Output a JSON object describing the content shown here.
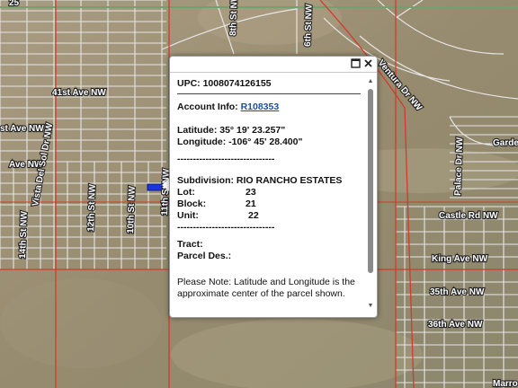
{
  "map": {
    "road_labels": [
      "25",
      "8th St NW",
      "6th St NW",
      "Ventura Dr NW",
      "41st Ave NW",
      "st Ave NW",
      "Ave NW",
      "Vista Del Sol Dr NW",
      "12th St NW",
      "14th St NW",
      "10th St NW",
      "11th St NW",
      "Garden",
      "Palace Dr NW",
      "Castle Rd NW",
      "King Ave NW",
      "35th Ave NW",
      "36th Ave NW",
      "Marro"
    ]
  },
  "popup": {
    "upc_label": "UPC:",
    "upc_value": "1008074126155",
    "account_label": "Account Info:",
    "account_value": "R108353",
    "latitude": "Latitude: 35° 19' 23.257\"",
    "longitude": "Longitude: -106° 45' 28.400\"",
    "dashes1": "-------------------------------",
    "subdivision_label": "Subdivision:",
    "subdivision_value": "RIO RANCHO ESTATES",
    "lot_label": "Lot:",
    "lot_value": "23",
    "block_label": "Block:",
    "block_value": "21",
    "unit_label": "Unit:",
    "unit_value": "22",
    "dashes2": "-------------------------------",
    "tract_label": "Tract:",
    "parcel_label": "Parcel Des.:",
    "note": "Please Note: Latitude and Longitude is the approximate center of the parcel shown.",
    "maximize_icon": "maximize-icon",
    "close_icon": "close-icon"
  },
  "colors": {
    "parcel_lines": "#e6e6e6",
    "red_boundary": "#d23a2a",
    "highlight": "#1a35d8"
  }
}
